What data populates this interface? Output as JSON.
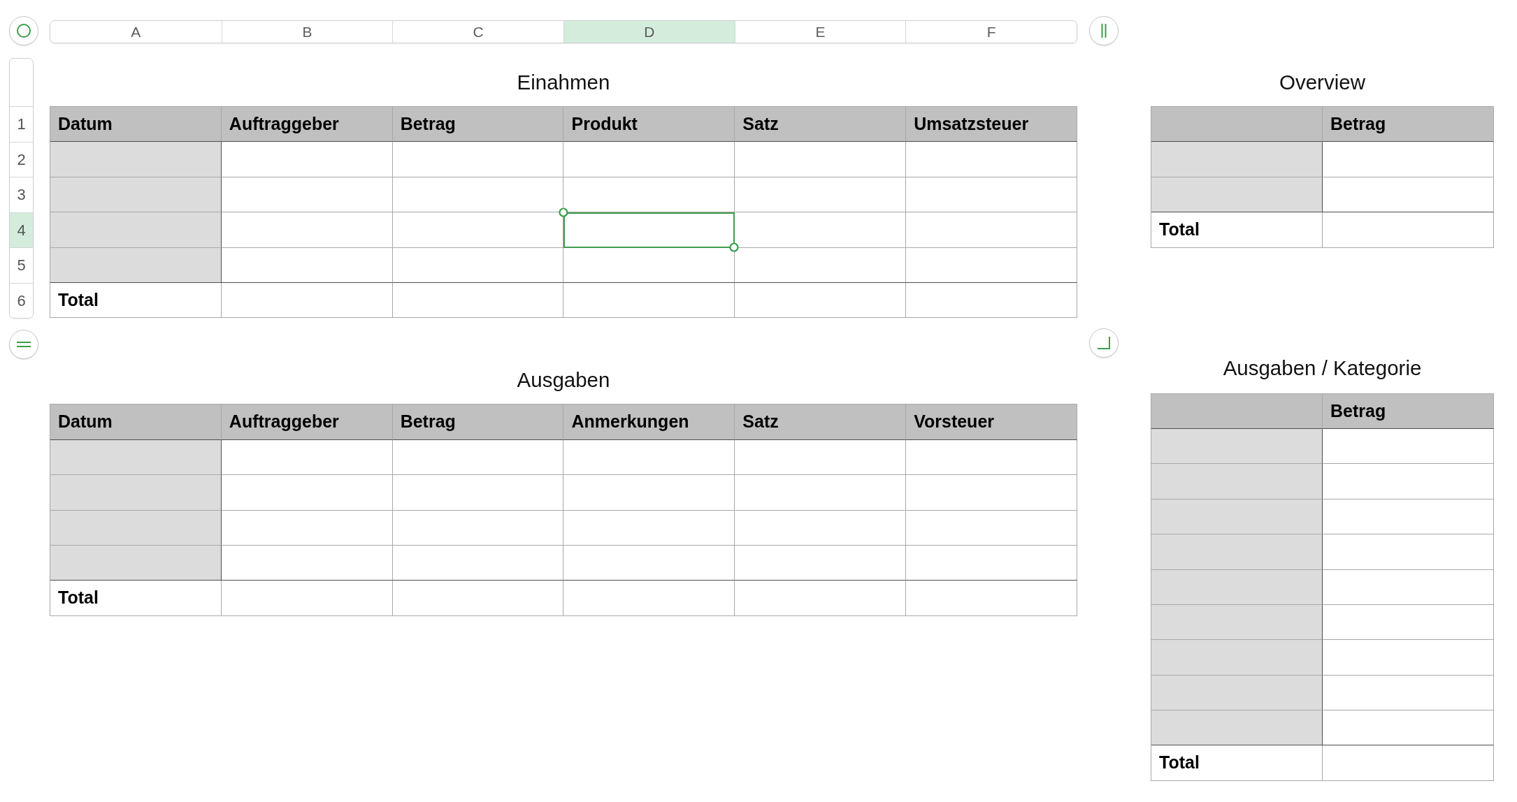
{
  "sheet": {
    "column_headers": [
      {
        "label": "A",
        "selected": false
      },
      {
        "label": "B",
        "selected": false
      },
      {
        "label": "C",
        "selected": false
      },
      {
        "label": "D",
        "selected": true
      },
      {
        "label": "E",
        "selected": false
      },
      {
        "label": "F",
        "selected": false
      }
    ],
    "row_headers": [
      {
        "label": "1",
        "selected": false
      },
      {
        "label": "2",
        "selected": false
      },
      {
        "label": "3",
        "selected": false
      },
      {
        "label": "4",
        "selected": true
      },
      {
        "label": "5",
        "selected": false
      },
      {
        "label": "6",
        "selected": false
      }
    ]
  },
  "main_tables": [
    {
      "title": "Einahmen",
      "columns": [
        {
          "label": "Datum",
          "selected": false
        },
        {
          "label": "Auftraggeber",
          "selected": false
        },
        {
          "label": "Betrag",
          "selected": false
        },
        {
          "label": "Produkt",
          "selected": false
        },
        {
          "label": "Satz",
          "selected": false
        },
        {
          "label": "Umsatzsteuer",
          "selected": false
        }
      ],
      "rows": [
        {
          "cells": [
            {
              "selected": false
            },
            {
              "selected": false
            },
            {
              "selected": false
            },
            {
              "selected": false
            },
            {
              "selected": false
            },
            {
              "selected": false
            }
          ]
        },
        {
          "cells": [
            {
              "selected": false
            },
            {
              "selected": false
            },
            {
              "selected": false
            },
            {
              "selected": false
            },
            {
              "selected": false
            },
            {
              "selected": false
            }
          ]
        },
        {
          "cells": [
            {
              "selected": false
            },
            {
              "selected": false
            },
            {
              "selected": false
            },
            {
              "selected": true
            },
            {
              "selected": false
            },
            {
              "selected": false
            }
          ]
        },
        {
          "cells": [
            {
              "selected": false
            },
            {
              "selected": false
            },
            {
              "selected": false
            },
            {
              "selected": false
            },
            {
              "selected": false
            },
            {
              "selected": false
            }
          ]
        }
      ],
      "footer": [
        {
          "label": "Total",
          "selected": false
        },
        {
          "selected": false
        },
        {
          "selected": false
        },
        {
          "selected": false
        },
        {
          "selected": false
        },
        {
          "selected": false
        }
      ]
    },
    {
      "title": "Ausgaben",
      "columns": [
        {
          "label": "Datum",
          "selected": false
        },
        {
          "label": "Auftraggeber",
          "selected": false
        },
        {
          "label": "Betrag",
          "selected": false
        },
        {
          "label": "Anmerkungen",
          "selected": false
        },
        {
          "label": "Satz",
          "selected": false
        },
        {
          "label": "Vorsteuer",
          "selected": false
        }
      ],
      "rows": [
        {
          "cells": [
            {
              "selected": false
            },
            {
              "selected": false
            },
            {
              "selected": false
            },
            {
              "selected": false
            },
            {
              "selected": false
            },
            {
              "selected": false
            }
          ]
        },
        {
          "cells": [
            {
              "selected": false
            },
            {
              "selected": false
            },
            {
              "selected": false
            },
            {
              "selected": false
            },
            {
              "selected": false
            },
            {
              "selected": false
            }
          ]
        },
        {
          "cells": [
            {
              "selected": false
            },
            {
              "selected": false
            },
            {
              "selected": false
            },
            {
              "selected": false
            },
            {
              "selected": false
            },
            {
              "selected": false
            }
          ]
        },
        {
          "cells": [
            {
              "selected": false
            },
            {
              "selected": false
            },
            {
              "selected": false
            },
            {
              "selected": false
            },
            {
              "selected": false
            },
            {
              "selected": false
            }
          ]
        }
      ],
      "footer": [
        {
          "label": "Total",
          "selected": false
        },
        {
          "selected": false
        },
        {
          "selected": false
        },
        {
          "selected": false
        },
        {
          "selected": false
        },
        {
          "selected": false
        }
      ]
    }
  ],
  "side_tables": [
    {
      "title": "Overview",
      "columns": [
        {
          "selected": false
        },
        {
          "label": "Betrag",
          "selected": false
        }
      ],
      "rows": [
        {
          "cells": [
            {
              "selected": false
            },
            {
              "selected": false
            }
          ]
        },
        {
          "cells": [
            {
              "selected": false
            },
            {
              "selected": false
            }
          ]
        }
      ],
      "footer": [
        {
          "label": "Total",
          "selected": false
        },
        {
          "selected": false
        }
      ]
    },
    {
      "title": "Ausgaben / Kategorie",
      "columns": [
        {
          "selected": false
        },
        {
          "label": "Betrag",
          "selected": false
        }
      ],
      "rows": [
        {
          "cells": [
            {
              "selected": false
            },
            {
              "selected": false
            }
          ]
        },
        {
          "cells": [
            {
              "selected": false
            },
            {
              "selected": false
            }
          ]
        },
        {
          "cells": [
            {
              "selected": false
            },
            {
              "selected": false
            }
          ]
        },
        {
          "cells": [
            {
              "selected": false
            },
            {
              "selected": false
            }
          ]
        },
        {
          "cells": [
            {
              "selected": false
            },
            {
              "selected": false
            }
          ]
        },
        {
          "cells": [
            {
              "selected": false
            },
            {
              "selected": false
            }
          ]
        },
        {
          "cells": [
            {
              "selected": false
            },
            {
              "selected": false
            }
          ]
        },
        {
          "cells": [
            {
              "selected": false
            },
            {
              "selected": false
            }
          ]
        },
        {
          "cells": [
            {
              "selected": false
            },
            {
              "selected": false
            }
          ]
        }
      ],
      "footer": [
        {
          "label": "Total",
          "selected": false
        },
        {
          "selected": false
        }
      ]
    }
  ]
}
